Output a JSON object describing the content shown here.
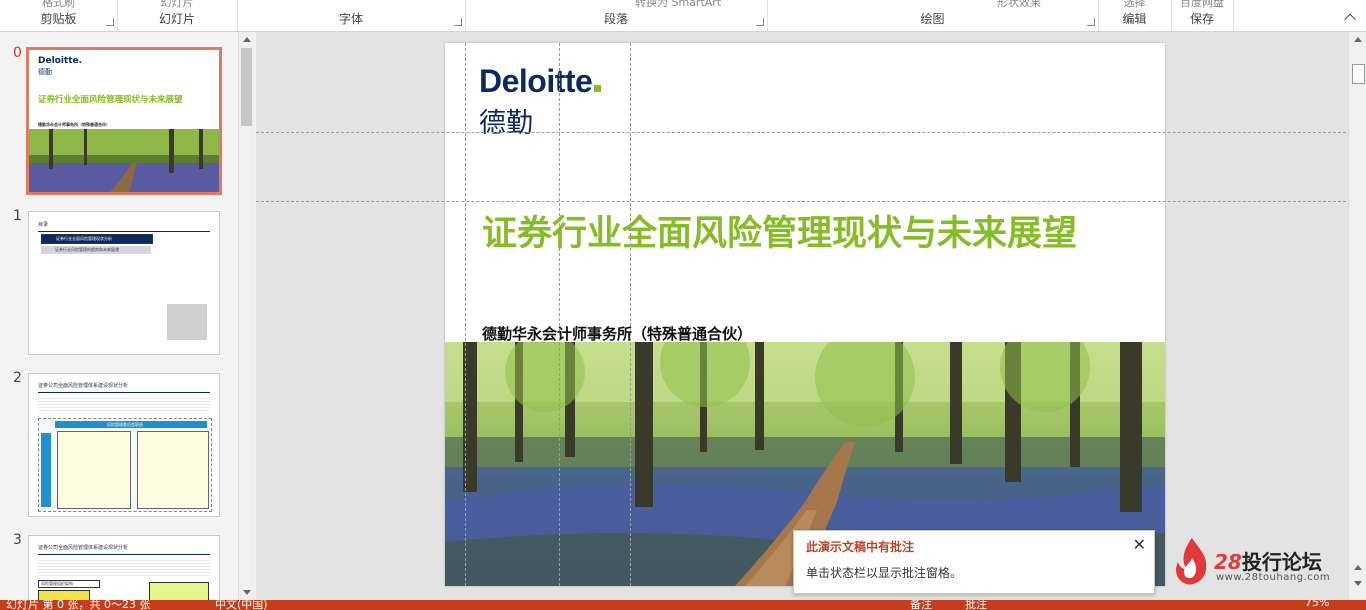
{
  "ribbon": {
    "groups": [
      {
        "name": "剪贴板",
        "cut_text": "格式刷"
      },
      {
        "name": "幻灯片",
        "cut_text": "幻灯片"
      },
      {
        "name": "字体",
        "cut_text": ""
      },
      {
        "name": "段落",
        "cut_text": "转换为 SmartArt"
      },
      {
        "name": "绘图",
        "cut_text": "形状效果"
      },
      {
        "name": "编辑",
        "cut_text": "选择"
      },
      {
        "name": "保存",
        "cut_text": "百度网盘"
      }
    ]
  },
  "thumbnails": [
    {
      "number": "0",
      "title": "证券行业全面风险管理现状与未来展望",
      "logo": "Deloitte.",
      "logo_cn": "德勤",
      "subtitle": "德勤华永会计师事务所（特殊普通合伙）"
    },
    {
      "number": "1",
      "heading": "目录",
      "items": [
        "证券行业全面风险管理现状分析",
        "证券行业风险管理的趋势和未来展望"
      ]
    },
    {
      "number": "2",
      "heading": "证券公司全面风险管理体系建设现状分析",
      "box_title": "风险管理委员会职责"
    },
    {
      "number": "3",
      "heading": "证券公司全面风险管理体系建设现状分析",
      "box_title": "风险管理组织架构"
    }
  ],
  "slide": {
    "logo_text": "Deloitte",
    "logo_cn": "德勤",
    "title": "证券行业全面风险管理现状与未来展望",
    "subtitle": "德勤华永会计师事务所（特殊普通合伙）"
  },
  "popup": {
    "title": "此演示文稿中有批注",
    "message": "单击状态栏以显示批注窗格。",
    "close_icon": "close-icon"
  },
  "watermark": {
    "num": "28",
    "name": "投行论坛",
    "url": "www.28touhang.com"
  },
  "status": {
    "slide_info": "幻灯片 第 0 张，共 0～23 张",
    "language": "中文(中国)",
    "notes": "备注",
    "comments": "批注",
    "zoom": "75%"
  },
  "colors": {
    "accent": "#c43e1c",
    "deloitte_blue": "#0b2a63",
    "deloitte_green": "#86bc25"
  }
}
